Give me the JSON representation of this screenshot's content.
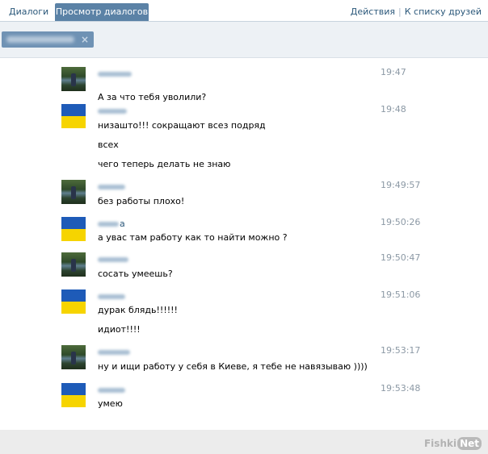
{
  "tabs": [
    {
      "label": "Диалоги",
      "active": false
    },
    {
      "label": "Просмотр диалогов",
      "active": true
    }
  ],
  "header_actions": {
    "actions_label": "Действия",
    "separator": "|",
    "to_friends_label": "К списку друзей"
  },
  "filter": {
    "chip_remove_icon": "×"
  },
  "colors": {
    "accent": "#5b82a6",
    "link": "#2b587a",
    "time": "#8c99a5",
    "flag_blue": "#1e5bb8",
    "flag_yellow": "#f6d400"
  },
  "messages": [
    {
      "avatar": "photo",
      "author_suffix": "",
      "time": "19:47",
      "lines": [
        "А за что тебя уволили?"
      ]
    },
    {
      "avatar": "flag",
      "author_suffix": "",
      "time": "19:48",
      "lines": [
        "низашто!!! сокращают всез подряд",
        "всех",
        "чего теперь делать не знаю"
      ]
    },
    {
      "avatar": "photo",
      "author_suffix": "",
      "time": "19:49:57",
      "lines": [
        "без работы плохо!"
      ]
    },
    {
      "avatar": "flag",
      "author_suffix": "а",
      "time": "19:50:26",
      "lines": [
        "а увас там работу как то найти можно ?"
      ]
    },
    {
      "avatar": "photo",
      "author_suffix": "",
      "time": "19:50:47",
      "lines": [
        "сосать умеешь?"
      ]
    },
    {
      "avatar": "flag",
      "author_suffix": "",
      "time": "19:51:06",
      "lines": [
        "дурак блядь!!!!!!",
        "идиот!!!!"
      ]
    },
    {
      "avatar": "photo",
      "author_suffix": "",
      "time": "19:53:17",
      "lines": [
        "ну и ищи работу у себя в Киеве, я тебе не навязываю ))))"
      ]
    },
    {
      "avatar": "flag",
      "author_suffix": "",
      "time": "19:53:48",
      "lines": [
        "умею"
      ]
    }
  ],
  "watermark": {
    "part1": "Fishki",
    "part2": "Net"
  }
}
